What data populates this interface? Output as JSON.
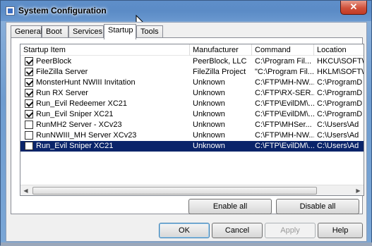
{
  "window": {
    "title": "System Configuration",
    "close_glyph": "✕"
  },
  "tabs": [
    {
      "label": "General",
      "active": false
    },
    {
      "label": "Boot",
      "active": false
    },
    {
      "label": "Services",
      "active": false
    },
    {
      "label": "Startup",
      "active": true
    },
    {
      "label": "Tools",
      "active": false
    }
  ],
  "table": {
    "columns": [
      "Startup Item",
      "Manufacturer",
      "Command",
      "Location"
    ],
    "rows": [
      {
        "checked": true,
        "item": "PeerBlock",
        "manufacturer": "PeerBlock, LLC",
        "command": "C:\\Program Fil...",
        "location": "HKCU\\SOFTW"
      },
      {
        "checked": true,
        "item": "FileZilla Server",
        "manufacturer": "FileZilla Project",
        "command": "\"C:\\Program Fil...",
        "location": "HKLM\\SOFTW"
      },
      {
        "checked": true,
        "item": "MonsterHunt NWIII Invitation",
        "manufacturer": "Unknown",
        "command": "C:\\FTP\\MH-NW...",
        "location": "C:\\ProgramD"
      },
      {
        "checked": true,
        "item": "Run RX Server",
        "manufacturer": "Unknown",
        "command": "C:\\FTP\\RX-SER...",
        "location": "C:\\ProgramD"
      },
      {
        "checked": true,
        "item": "Run_Evil Redeemer XC21",
        "manufacturer": "Unknown",
        "command": "C:\\FTP\\EvilDM\\...",
        "location": "C:\\ProgramD"
      },
      {
        "checked": true,
        "item": "Run_Evil Sniper XC21",
        "manufacturer": "Unknown",
        "command": "C:\\FTP\\EvilDM\\...",
        "location": "C:\\ProgramD"
      },
      {
        "checked": false,
        "item": "RunMH2 Server - XCv23",
        "manufacturer": "Unknown",
        "command": "C:\\FTP\\MHSer...",
        "location": "C:\\Users\\Ad"
      },
      {
        "checked": false,
        "item": "RunNWIII_MH Server XCv23",
        "manufacturer": "Unknown",
        "command": "C:\\FTP\\MH-NW...",
        "location": "C:\\Users\\Ad"
      },
      {
        "checked": false,
        "item": "Run_Evil Sniper XC21",
        "manufacturer": "Unknown",
        "command": "C:\\FTP\\EvilDM\\...",
        "location": "C:\\Users\\Ad",
        "selected": true
      }
    ]
  },
  "scroll": {
    "left_glyph": "◀",
    "right_glyph": "▶"
  },
  "buttons": {
    "enable_all": "Enable all",
    "disable_all": "Disable all",
    "ok": "OK",
    "cancel": "Cancel",
    "apply": "Apply",
    "help": "Help"
  },
  "colors": {
    "selection": "#0a246a",
    "close": "#c13b26"
  }
}
